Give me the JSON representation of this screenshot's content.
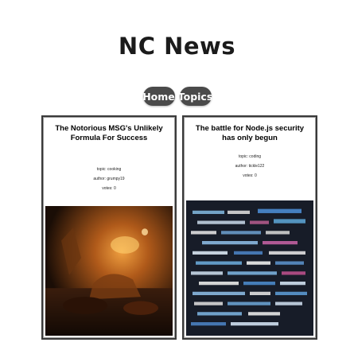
{
  "header": {
    "title": "NC News"
  },
  "nav": {
    "home_label": "Home",
    "topics_label": "Topics"
  },
  "articles": [
    {
      "title": "The Notorious MSG's Unlikely Formula For Success",
      "topic": "topic: cooking",
      "author": "author: grumpy19",
      "votes": "votes: 0"
    },
    {
      "title": "The battle for Node.js security has only begun",
      "topic": "topic: coding",
      "author": "author: tickle122",
      "votes": "votes: 0"
    }
  ]
}
